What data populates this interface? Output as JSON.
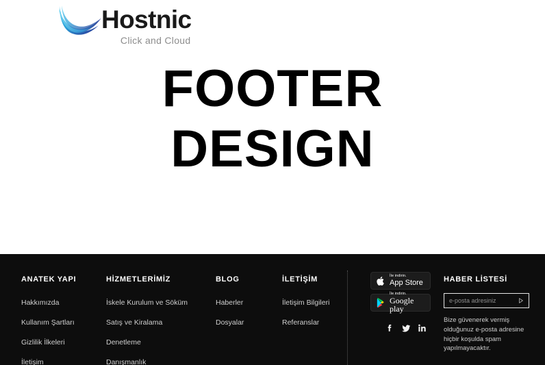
{
  "brand": {
    "name": "Hostnic",
    "tagline": "Click and Cloud",
    "logo_icon": "wave-swoosh-icon",
    "gradient_from": "#4ec8ec",
    "gradient_to": "#2a2a8c"
  },
  "hero": {
    "line1": "FOOTER",
    "line2": "DESIGN"
  },
  "footer": {
    "background": "#0d0d0d",
    "text_color": "#cfcfcf",
    "columns": [
      {
        "heading": "ANATEK YAPI",
        "links": [
          "Hakkımızda",
          "Kullanım Şartları",
          "Gizlilik İlkeleri",
          "İletişim"
        ]
      },
      {
        "heading": "HİZMETLERİMİZ",
        "links": [
          "İskele Kurulum ve Söküm",
          "Satış ve Kiralama",
          "Denetleme",
          "Danışmanlık"
        ]
      },
      {
        "heading": "BLOG",
        "links": [
          "Haberler",
          "Dosyalar"
        ]
      },
      {
        "heading": "İLETİŞİM",
        "links": [
          "İletişim Bilgileri",
          "Referanslar"
        ]
      }
    ],
    "stores": [
      {
        "icon": "apple-icon",
        "small": "İle indirin.",
        "big": "App Store"
      },
      {
        "icon": "google-play-icon",
        "small": "İle indirin.",
        "big": "Google play"
      }
    ],
    "socials": [
      {
        "icon": "facebook-icon",
        "label": "f"
      },
      {
        "icon": "twitter-icon",
        "label": "t"
      },
      {
        "icon": "linkedin-icon",
        "label": "in"
      }
    ],
    "newsletter": {
      "heading": "HABER LİSTESİ",
      "placeholder": "e-posta adresiniz",
      "value": "",
      "submit_icon": "play-arrow-icon",
      "note": "Bize güvenerek vermiş olduğunuz e-posta adresine hiçbir koşulda spam yapılmayacaktır."
    }
  }
}
